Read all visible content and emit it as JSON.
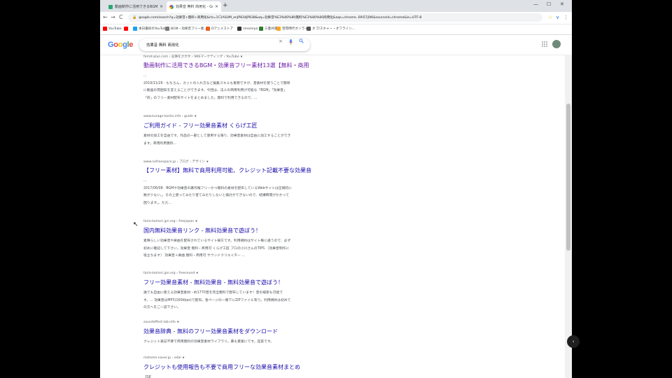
{
  "tabs": [
    {
      "title": "動画制作に活用できるBGM・効果...",
      "close": "×"
    },
    {
      "title": "効果音 無料 商用化 - Google 検索",
      "close": "×"
    }
  ],
  "new_tab_label": "+",
  "window_controls": {
    "minimize": "—",
    "maximize": "☐",
    "close": "✕"
  },
  "toolbar": {
    "back": "←",
    "forward": "→",
    "reload": "C",
    "url": "google.com/search?q=効果音+無料+商用化&rlz=1C1ASUM_enJP834JP838&oq=効果音%E3%80%80無料%E3%80%80商用化&aqs=chrome..69i57j0l6&sourceid=chrome&ie=UTF-8"
  },
  "bookmarks": [
    {
      "label": "YouTube",
      "color": "#ff0000"
    },
    {
      "label": "",
      "color": "#ff0000"
    },
    {
      "label": "本日最初のYouTube...",
      "color": "#1da1f2"
    },
    {
      "label": "BGM・効果音フリー素...",
      "color": "#7b7b7b"
    },
    {
      "label": "Dアニメストア",
      "color": "#e5611e"
    },
    {
      "label": "ninomiya",
      "color": "#333333"
    },
    {
      "label": "三菱弁護",
      "color": "#2e7d32"
    },
    {
      "label": "蛍雪時代オンライン",
      "color": "#f9a825"
    },
    {
      "label": "オプ/スキャー・オフライン...",
      "color": "#555555"
    }
  ],
  "google": {
    "logo_letters": [
      {
        "ch": "G",
        "color": "#4285f4"
      },
      {
        "ch": "o",
        "color": "#ea4335"
      },
      {
        "ch": "o",
        "color": "#fbbc05"
      },
      {
        "ch": "g",
        "color": "#4285f4"
      },
      {
        "ch": "l",
        "color": "#34a853"
      },
      {
        "ch": "e",
        "color": "#ea4335"
      }
    ],
    "query": "効果音 無料 商用化",
    "clear_icon": "×",
    "mic_icon": "🎙",
    "search_icon": "⌕"
  },
  "results": [
    {
      "cite": "ferret-plus.com › 記事をさがす › SNSマーケティング › YouTube",
      "title": "動画制作に活用できるBGM・効果音フリー素材13選【無料・商用",
      "visited": true,
      "snippet": "...\n2019/11/26 · もちろん、カットの入れ方など編集スキルも重要ですが、音素材を使うことで簡単に動画の雰囲気を変えることができます。今回は、法人の商用利用が可能な「BGM」「効果音」「声」のフリー素材配布サイトをまとめました。無料で利用できるので、..."
    },
    {
      "cite": "www.kurage-kosho.info › guide",
      "title": "ご利用ガイド - フリー効果音素材 くらげ工匠",
      "visited": false,
      "snippet": "素材の加工を自由です。作品の一部として使用する限り、効果音素材は自由に加工することができます。商用利用無料..."
    },
    {
      "cite": "www.nofreespace.jp › ブログ › デザイン",
      "title": "【フリー素材】無料で商用利用可能、クレジット記載不要な効果音",
      "visited": false,
      "snippet": "...\n2017/06/08 · BGMや効果音の著作権フリーかつ無料の素材を配布しているWebサイトは圧倒的に数が少ない。。その上使ってみたり音てみたりしないと検討ができないので、結構時間がかかって困ります。。ただ..."
    },
    {
      "cite": "taira-komori.jpn.org › freejapan",
      "title": "国内無料効果音リンク - 無料効果音で遊ぼう！",
      "visited": false,
      "snippet": "素晴らしい効果音や楽曲を配布されているサイト様方です。利用規約はサイト毎に違うので、必ず初めに確認して下さい。効果音 無料・商用可 くらげ工匠 プロの小川さんのTIPS 〔効果音制作に役立ちます〕 効果音＋楽曲 無料・商用可 サウンドクリエイター ..."
    },
    {
      "cite": "taira-komori.jpn.org › freesound",
      "title": "フリー効果音素材 - 無料効果音 - 無料効果音で遊ぼう！",
      "visited": false,
      "snippet": "誰でも自由に使える効果音素材・約1770音を完全無料で配布しています！音の検索も可能です。... 効果音はMP3(160kbps)で配布。各ページの一番下にZIPファイル有り。利用規約は初めての方へをご一読下さい。"
    },
    {
      "cite": "soundeffect-lab.info",
      "title": "効果音辞典 - 無料のフリー効果音素材をダウンロード",
      "visited": false,
      "snippet": "クレジット表記不要で商用無料の効果音素材ライブラリ。著も豊富にです。品質です。"
    },
    {
      "cite": "motome.naver.jp › odai",
      "title": "クレジットも使用報告も不要で商用フリーな効果音素材まとめ",
      "visited": false,
      "snippet": "【SE"
    }
  ],
  "colors": {
    "link": "#1a0dab",
    "visited_link": "#681da8",
    "cite": "#5f6368",
    "snippet": "#4d5156"
  },
  "side_button_icon": "‹",
  "cursor_icon": "↖"
}
